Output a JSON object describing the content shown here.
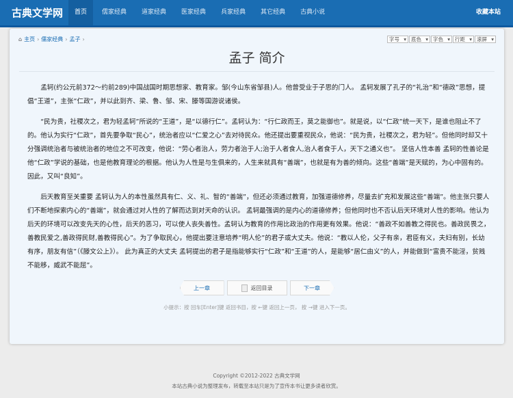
{
  "nav": {
    "logo": "古典文学网",
    "items": [
      "首页",
      "儒家经典",
      "道家经典",
      "医家经典",
      "兵家经典",
      "其它经典",
      "古典小说"
    ],
    "favorite": "收藏本站"
  },
  "breadcrumb": [
    "主页",
    "儒家经典",
    "孟子"
  ],
  "selects": [
    "字号",
    "底色",
    "字色",
    "行距",
    "滚屏"
  ],
  "title": "孟子 简介",
  "paragraphs": [
    "孟轲(约公元前372～约前289)中国战国时期思想家、教育家。邹(今山东省邹县)人。他曾受业于子思的门人。 孟轲发展了孔子的“礼治”和“德政”思想，提倡“王道”，主张“仁政”，并以此到齐、梁、鲁、邹、宋、滕等国游说诸侯。",
    "“民为贵，社稷次之，君为轻孟轲”所说的“王道”，是“以德行仁”。孟轲认为：“行仁政而王，莫之能御也”。就是说，以“仁政”统一天下，是谁也阻止不了的。他认为实行“仁政”，首先要争取“民心”，统治者应以“仁爱之心”去对待民众。他还提出要重视民众，他说：“民为贵，社稷次之，君为轻”。但他同时却又十分强调统治者与被统治者的地位之不可改变，他说：“劳心者治人，劳力者治于人;治于人者食人,治人者食于人，天下之通义也”。 坚信人性本善 孟轲的性善论是他“仁政”学说的基础，也是他教育理论的根据。他认为人性是与生俱来的，人生来就具有“善端”，也就是有为善的倾向。这些“善端”是天赋的，为心中固有的。因此，又叫“良知”。",
    "后天教育至关重要 孟轲认为人的本性虽然具有仁、义、礼、智的“善端”，但还必须通过教育，加强道德修养，尽量去扩充和发展这些“善端”。他主张只要人们不断地探索内心的“善端”，就会通过对人性的了解而达到对天命的认识。 孟轲最强调的是内心的道德修养；但他同时也不否认后天环境对人性的影响。他认为后天的环境可以改变先天的心性，后天的恶习，可以使人丧失善性。孟轲认为教育的作用比政治的作用更有效果。他说：“善政不如善教之得民也。善政民畏之，善教民爱之,善政得民财,善教得民心”。为了争取民心，他提出要注意培养“明人伦”的君子或大丈夫。他说：“教以人伦，父子有亲，君臣有义，夫妇有别，长幼有序，朋友有信”（《滕文公上》）。 此为真正的大丈夫 孟轲提出的君子是指能够实行“仁政”和“王道”的人，是能够“居仁由义”的人，并能做到“富贵不能淫，贫贱不能移，威武不能屈”。"
  ],
  "buttons": {
    "prev": "上一章",
    "back": "返回目录",
    "next": "下一章"
  },
  "tip": "小提示：按 回车[Enter]键 返回书目，按 ←键 返回上一页， 按 →键 进入下一页。",
  "footer": {
    "copyright": "Copyright ©2012-2022 古典文学网",
    "note": "本站古典小说为整理发布，转载至本站只是为了宣传本书让更多读者欣赏。"
  }
}
